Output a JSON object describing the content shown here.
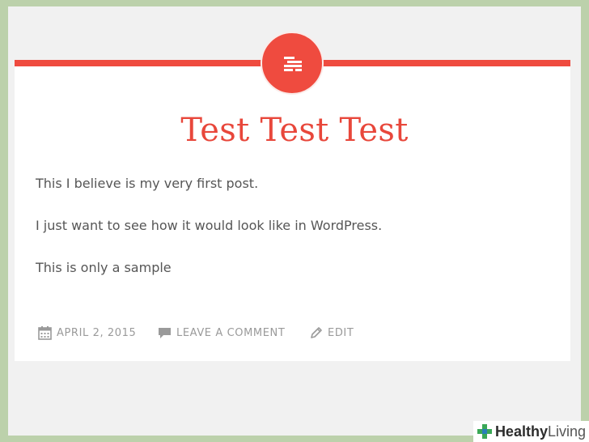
{
  "post": {
    "title": "Test Test Test",
    "paragraphs": [
      "This I believe is my very first post.",
      "I just want to see how it would look like in WordPress.",
      "This is only a sample"
    ],
    "meta": {
      "date": "APRIL 2, 2015",
      "comment": "LEAVE A COMMENT",
      "edit": "EDIT"
    }
  },
  "icons": {
    "post_format": "standard-post-format-icon",
    "date": "calendar-icon",
    "comment": "speech-bubble-icon",
    "edit": "pencil-icon"
  },
  "colors": {
    "accent": "#ef4b3f",
    "title": "#e8473b",
    "page_background": "#f1f1f1",
    "outer_background": "#bcd1ab",
    "meta_text": "#9a9a9a"
  },
  "watermark": {
    "part1": "Healthy",
    "part2": "Living"
  }
}
